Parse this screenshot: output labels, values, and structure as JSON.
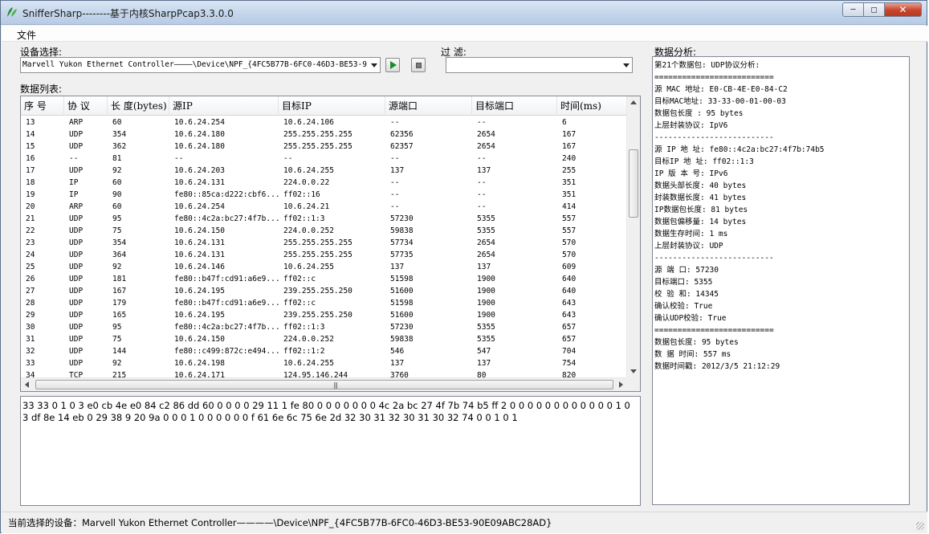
{
  "window": {
    "title": "SnifferSharp--------基于内核SharpPcap3.3.0.0"
  },
  "menu": {
    "file": "文件"
  },
  "device": {
    "label": "设备选择:",
    "selected": "Marvell Yukon Ethernet Controller————\\Device\\NPF_{4FC5B77B-6FC0-46D3-BE53-9"
  },
  "filter": {
    "label": "过 滤:",
    "value": ""
  },
  "list": {
    "label": "数据列表:",
    "columns": [
      "序 号",
      "协 议",
      "长 度(bytes)",
      "源IP",
      "目标IP",
      "源端口",
      "目标端口",
      "时间(ms)"
    ],
    "rows": [
      [
        "13",
        "ARP",
        "60",
        "10.6.24.254",
        "10.6.24.106",
        "--",
        "--",
        "6"
      ],
      [
        "14",
        "UDP",
        "354",
        "10.6.24.180",
        "255.255.255.255",
        "62356",
        "2654",
        "167"
      ],
      [
        "15",
        "UDP",
        "362",
        "10.6.24.180",
        "255.255.255.255",
        "62357",
        "2654",
        "167"
      ],
      [
        "16",
        "--",
        "81",
        "--",
        "--",
        "--",
        "--",
        "240"
      ],
      [
        "17",
        "UDP",
        "92",
        "10.6.24.203",
        "10.6.24.255",
        "137",
        "137",
        "255"
      ],
      [
        "18",
        "IP",
        "60",
        "10.6.24.131",
        "224.0.0.22",
        "--",
        "--",
        "351"
      ],
      [
        "19",
        "IP",
        "90",
        "fe80::85ca:d222:cbf6...",
        "ff02::16",
        "--",
        "--",
        "351"
      ],
      [
        "20",
        "ARP",
        "60",
        "10.6.24.254",
        "10.6.24.21",
        "--",
        "--",
        "414"
      ],
      [
        "21",
        "UDP",
        "95",
        "fe80::4c2a:bc27:4f7b...",
        "ff02::1:3",
        "57230",
        "5355",
        "557"
      ],
      [
        "22",
        "UDP",
        "75",
        "10.6.24.150",
        "224.0.0.252",
        "59838",
        "5355",
        "557"
      ],
      [
        "23",
        "UDP",
        "354",
        "10.6.24.131",
        "255.255.255.255",
        "57734",
        "2654",
        "570"
      ],
      [
        "24",
        "UDP",
        "364",
        "10.6.24.131",
        "255.255.255.255",
        "57735",
        "2654",
        "570"
      ],
      [
        "25",
        "UDP",
        "92",
        "10.6.24.146",
        "10.6.24.255",
        "137",
        "137",
        "609"
      ],
      [
        "26",
        "UDP",
        "181",
        "fe80::b47f:cd91:a6e9...",
        "ff02::c",
        "51598",
        "1900",
        "640"
      ],
      [
        "27",
        "UDP",
        "167",
        "10.6.24.195",
        "239.255.255.250",
        "51600",
        "1900",
        "640"
      ],
      [
        "28",
        "UDP",
        "179",
        "fe80::b47f:cd91:a6e9...",
        "ff02::c",
        "51598",
        "1900",
        "643"
      ],
      [
        "29",
        "UDP",
        "165",
        "10.6.24.195",
        "239.255.255.250",
        "51600",
        "1900",
        "643"
      ],
      [
        "30",
        "UDP",
        "95",
        "fe80::4c2a:bc27:4f7b...",
        "ff02::1:3",
        "57230",
        "5355",
        "657"
      ],
      [
        "31",
        "UDP",
        "75",
        "10.6.24.150",
        "224.0.0.252",
        "59838",
        "5355",
        "657"
      ],
      [
        "32",
        "UDP",
        "144",
        "fe80::c499:872c:e494...",
        "ff02::1:2",
        "546",
        "547",
        "704"
      ],
      [
        "33",
        "UDP",
        "92",
        "10.6.24.198",
        "10.6.24.255",
        "137",
        "137",
        "754"
      ],
      [
        "34",
        "TCP",
        "215",
        "10.6.24.171",
        "124.95.146.244",
        "3760",
        "80",
        "820"
      ]
    ]
  },
  "hex": "33 33 0 1 0 3 e0 cb 4e e0 84 c2 86 dd 60 0 0 0 0 29 11 1 fe 80 0 0 0 0 0 0 0 4c 2a bc 27 4f 7b 74 b5 ff 2 0 0 0 0 0 0 0 0 0 0 0 0 1 0 3 df 8e 14 eb 0 29 38 9 20 9a 0 0 0 1 0 0 0 0 0 0 f 61 6e 6c 75 6e 2d 32 30 31 32 30 31 30 32 74 0 0 1 0 1",
  "analysis": {
    "label": "数据分析:",
    "lines": [
      "第21个数据包: UDP协议分析:",
      "==========================",
      "源 MAC 地址: E0-CB-4E-E0-84-C2",
      "目标MAC地址: 33-33-00-01-00-03",
      "数据包长度 : 95 bytes",
      "上层封装协议: IpV6",
      "--------------------------",
      "源 IP  地 址: fe80::4c2a:bc27:4f7b:74b5",
      "目标IP 地 址: ff02::1:3",
      "IP  版 本 号: IPv6",
      "数据头部长度: 40 bytes",
      "封装数据长度: 41 bytes",
      "IP数据包长度: 81 bytes",
      "数据包偏移量: 14 bytes",
      "数据生存时间: 1 ms",
      "上层封装协议: UDP",
      "--------------------------",
      "源 端 口: 57230",
      "目标端口: 5355",
      "校 验 和: 14345",
      "确认校验: True",
      "确认UDP校验: True",
      "==========================",
      "数据包长度: 95 bytes",
      "数 据 时间: 557 ms",
      "数据时间戳: 2012/3/5 21:12:29"
    ]
  },
  "status": {
    "text": "当前选择的设备：Marvell Yukon Ethernet Controller————\\Device\\NPF_{4FC5B77B-6FC0-46D3-BE53-90E09ABC28AD}"
  },
  "icons": {
    "app": "sniffer-logo-icon",
    "start": "play-icon",
    "stop": "stop-icon"
  },
  "colors": {
    "title_bar": "#c6d7ec",
    "close": "#c7432c",
    "play": "#1c8c2a"
  }
}
